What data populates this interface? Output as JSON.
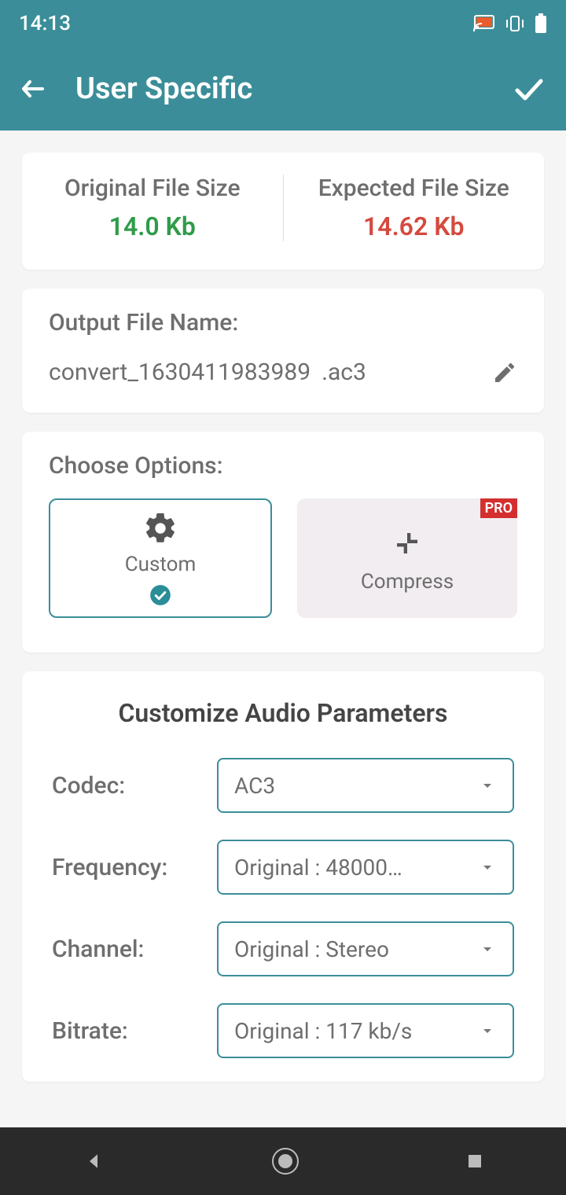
{
  "status": {
    "time": "14:13"
  },
  "appbar": {
    "title": "User Specific"
  },
  "filesize": {
    "original_label": "Original File Size",
    "original_value": "14.0 Kb",
    "expected_label": "Expected File Size",
    "expected_value": "14.62 Kb"
  },
  "output": {
    "label": "Output File Name:",
    "name": "convert_1630411983989",
    "ext": ".ac3"
  },
  "options": {
    "title": "Choose Options:",
    "custom_label": "Custom",
    "compress_label": "Compress",
    "pro_badge": "PRO"
  },
  "params": {
    "title": "Customize Audio Parameters",
    "codec": {
      "label": "Codec:",
      "value": "AC3"
    },
    "frequency": {
      "label": "Frequency:",
      "value": "Original : 48000…"
    },
    "channel": {
      "label": "Channel:",
      "value": "Original : Stereo"
    },
    "bitrate": {
      "label": "Bitrate:",
      "value": "Original : 117 kb/s"
    }
  }
}
